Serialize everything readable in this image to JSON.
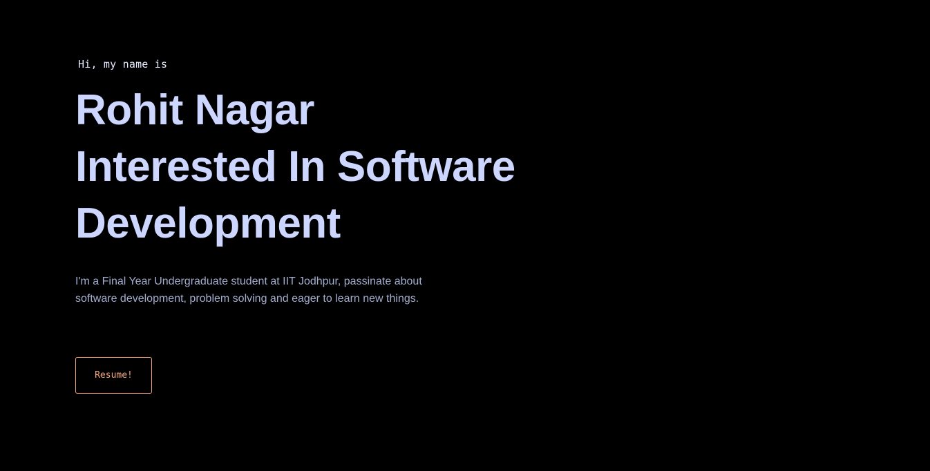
{
  "hero": {
    "greeting": "Hi, my name is",
    "name": "Rohit Nagar",
    "tagline_line1": "Interested In Software",
    "tagline_line2": "Development",
    "bio": "I'm a Final Year Undergraduate student at IIT Jodhpur, passinate about software development, problem solving and eager to learn new things.",
    "resume_label": "Resume!"
  },
  "colors": {
    "background": "#000000",
    "heading": "#cdd6ff",
    "body_text": "#a3adce",
    "accent": "#f6a87c"
  }
}
